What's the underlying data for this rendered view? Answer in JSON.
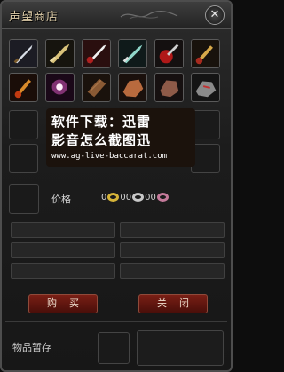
{
  "window": {
    "title": "声望商店",
    "close_label": "✕"
  },
  "shop_items": [
    {
      "icon": "sword-item-icon"
    },
    {
      "icon": "golden-blade-item-icon"
    },
    {
      "icon": "ice-sword-item-icon"
    },
    {
      "icon": "teal-blade-item-icon"
    },
    {
      "icon": "red-gem-item-icon"
    },
    {
      "icon": "golden-wand-item-icon"
    },
    {
      "icon": "fire-wand-item-icon"
    },
    {
      "icon": "magic-burst-item-icon"
    },
    {
      "icon": "wood-log-item-icon"
    },
    {
      "icon": "copper-ore-item-icon"
    },
    {
      "icon": "bronze-ore-item-icon"
    },
    {
      "icon": "iron-ore-item-icon"
    }
  ],
  "overlay": {
    "line1": "软件下载：迅雷",
    "line2": "影音怎么截图迅",
    "url": "www.ag-live-baccarat.com"
  },
  "price": {
    "label": "价格",
    "gold": "0",
    "silver": "00",
    "pink": "00"
  },
  "buttons": {
    "buy": "购买",
    "close": "关闭"
  },
  "storage": {
    "label": "物品暂存"
  },
  "colors": {
    "button_red": "#7a1f15",
    "gold": "#d6b439",
    "title_text": "#d9c8a4"
  }
}
